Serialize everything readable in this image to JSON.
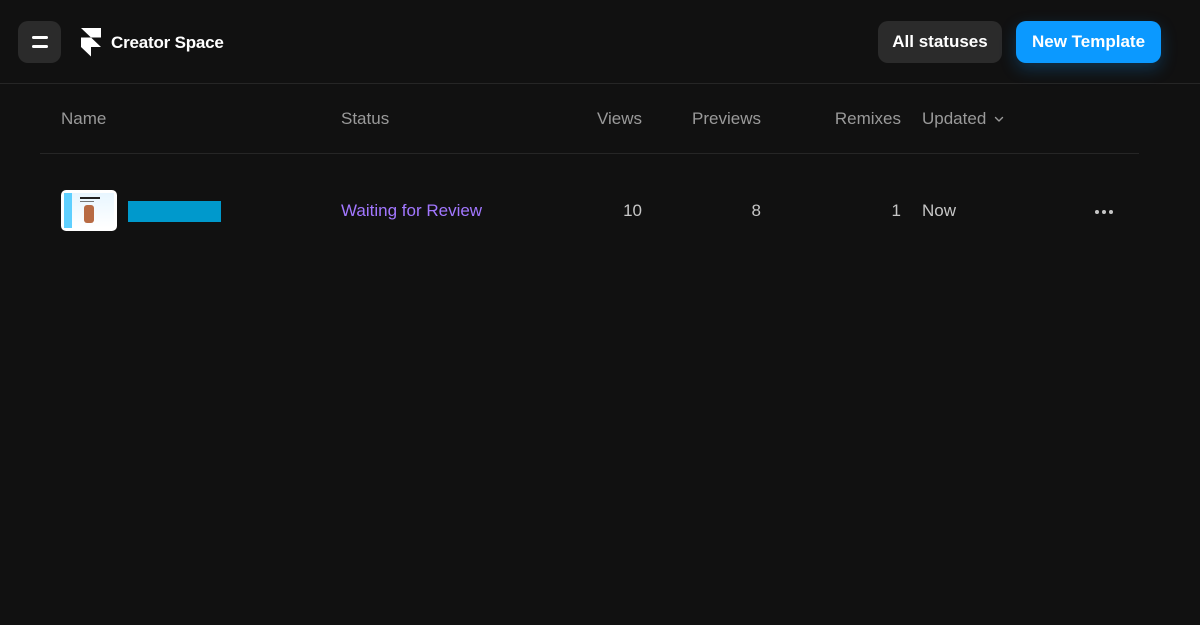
{
  "header": {
    "brand_name": "Creator Space",
    "status_filter_label": "All statuses",
    "new_template_label": "New Template"
  },
  "table": {
    "columns": {
      "name": "Name",
      "status": "Status",
      "views": "Views",
      "previews": "Previews",
      "remixes": "Remixes",
      "updated": "Updated"
    },
    "rows": [
      {
        "name": "",
        "status": "Waiting for Review",
        "views": "10",
        "previews": "8",
        "remixes": "1",
        "updated": "Now"
      }
    ]
  },
  "colors": {
    "background": "#111111",
    "accent": "#0b99ff",
    "status_pending": "#a277ff",
    "redaction": "#0099cc"
  },
  "icons": {
    "menu": "hamburger-icon",
    "logo": "framer-logo-icon",
    "sort": "chevron-down-icon",
    "more": "more-horizontal-icon"
  }
}
